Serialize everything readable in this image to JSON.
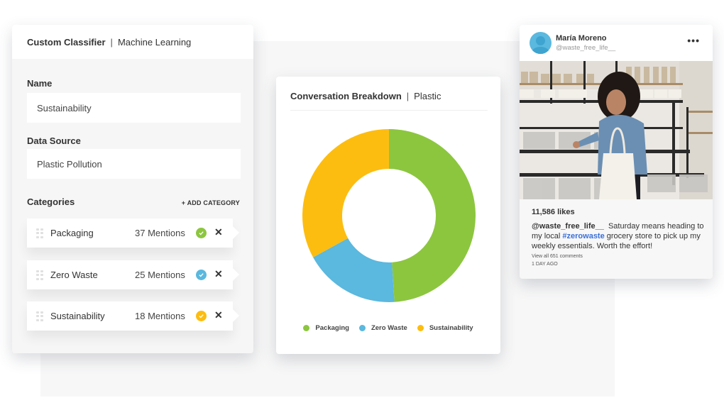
{
  "classifier": {
    "title": "Custom Classifier",
    "separator": "|",
    "subtitle": "Machine Learning",
    "name_label": "Name",
    "name_value": "Sustainability",
    "source_label": "Data Source",
    "source_value": "Plastic Pollution",
    "categories_label": "Categories",
    "add_category_label": "+ ADD CATEGORY",
    "categories": [
      {
        "name": "Packaging",
        "mentions": "37 Mentions",
        "color": "#8cc63f"
      },
      {
        "name": "Zero Waste",
        "mentions": "25 Mentions",
        "color": "#5bb8de"
      },
      {
        "name": "Sustainability",
        "mentions": "18 Mentions",
        "color": "#fdbd10"
      }
    ]
  },
  "chart_card": {
    "title": "Conversation Breakdown",
    "separator": "|",
    "subtitle": "Plastic"
  },
  "chart_data": {
    "type": "pie",
    "variant": "donut",
    "title": "Conversation Breakdown | Plastic",
    "categories": [
      "Packaging",
      "Zero Waste",
      "Sustainability"
    ],
    "values": [
      49,
      18,
      33
    ],
    "colors": [
      "#8cc63f",
      "#5bb8de",
      "#fdbd10"
    ],
    "start_angle_deg": 0,
    "direction": "clockwise",
    "legend_position": "bottom"
  },
  "social_post": {
    "user_name": "María Moreno",
    "user_handle": "@waste_free_life__",
    "more_icon": "ellipsis-icon",
    "likes": "11,586 likes",
    "caption_handle": "@waste_free_life__",
    "caption_before": "  Saturday means heading to my local ",
    "caption_hashtag": "#zerowaste",
    "caption_after": " grocery store to pick up my weekly essentials. Worth the effort!",
    "comments_link": "View all 651 comments",
    "timestamp": "1 DAY AGO"
  }
}
